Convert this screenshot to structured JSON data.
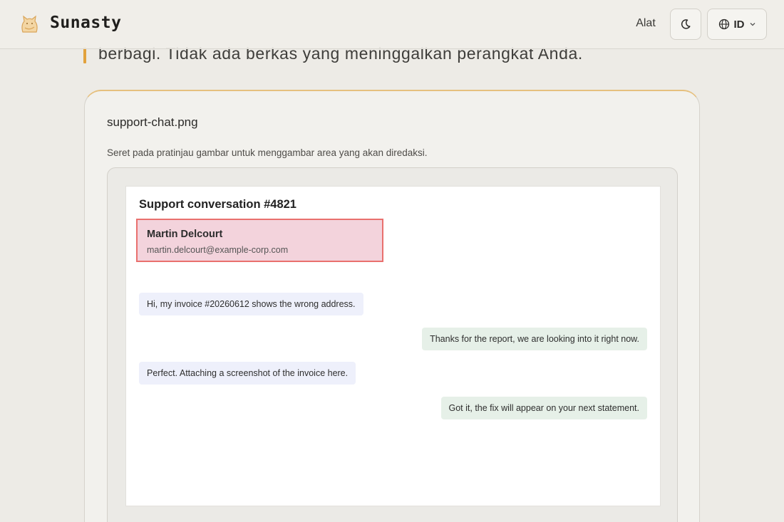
{
  "header": {
    "brand": "Sunasty",
    "nav_tools": "Alat",
    "language": "ID",
    "icons": {
      "logo": "cat-logo-icon",
      "theme": "moon-icon",
      "language": "globe-icon",
      "dropdown": "chevron-down-icon"
    }
  },
  "intro": {
    "text": "berbagi. Tidak ada berkas yang meninggalkan perangkat Anda."
  },
  "card": {
    "file_name": "support-chat.png",
    "hint": "Seret pada pratinjau gambar untuk menggambar area yang akan diredaksi."
  },
  "preview": {
    "title": "Support conversation #4821",
    "contact": {
      "name": "Martin Delcourt",
      "email": "martin.delcourt@example-corp.com"
    },
    "messages": [
      {
        "side": "in",
        "text": "Hi, my invoice #20260612 shows the wrong address."
      },
      {
        "side": "out",
        "text": "Thanks for the report, we are looking into it right now."
      },
      {
        "side": "in",
        "text": "Perfect. Attaching a screenshot of the invoice here."
      },
      {
        "side": "out",
        "text": "Got it, the fix will appear on your next statement."
      }
    ]
  },
  "colors": {
    "accent": "#e2a23d",
    "redaction_fill": "#f3d3dc",
    "redaction_border": "#e9706e"
  }
}
